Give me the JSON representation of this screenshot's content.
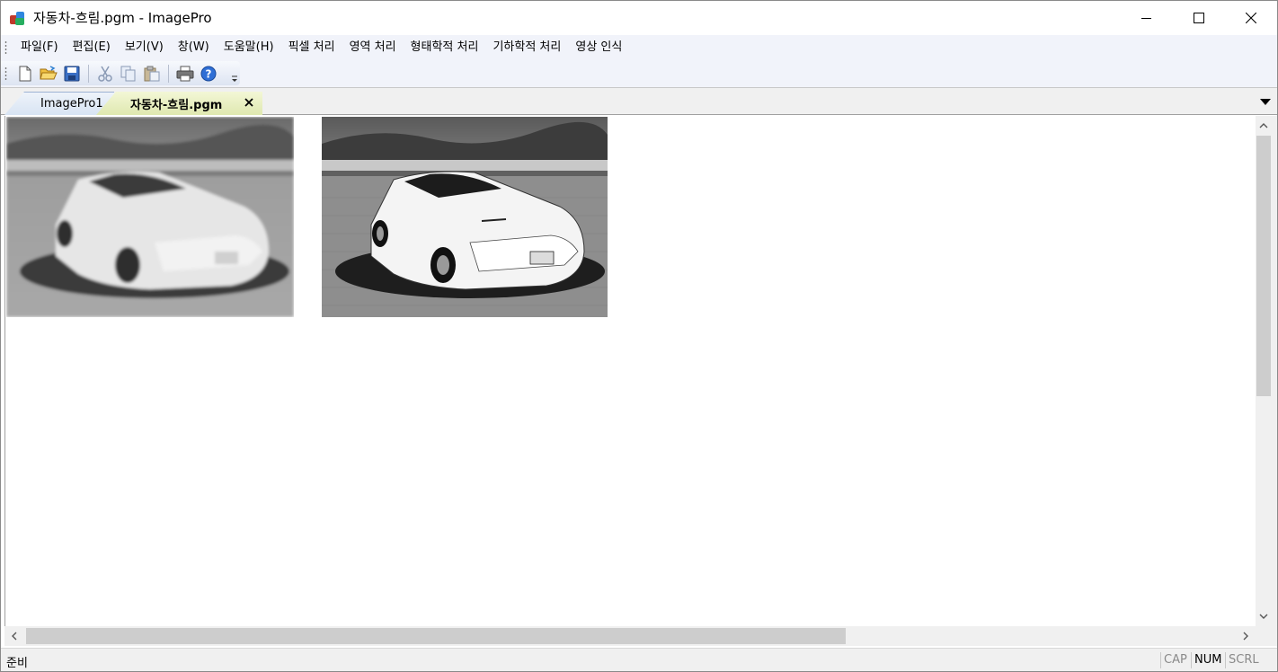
{
  "window": {
    "title": "자동차-흐림.pgm - ImagePro"
  },
  "menu": {
    "items": [
      "파일(F)",
      "편집(E)",
      "보기(V)",
      "창(W)",
      "도움말(H)",
      "픽셀 처리",
      "영역 처리",
      "형태학적 처리",
      "기하학적 처리",
      "영상 인식"
    ]
  },
  "toolbar": {
    "buttons": [
      "new-file-icon",
      "open-folder-icon",
      "save-icon",
      "cut-icon",
      "copy-icon",
      "paste-icon",
      "print-icon",
      "help-icon"
    ]
  },
  "tabs": [
    {
      "label": "ImagePro1"
    },
    {
      "label": "자동차-흐림.pgm"
    }
  ],
  "images": [
    {
      "name": "original-blurred-car"
    },
    {
      "name": "processed-car"
    }
  ],
  "status": {
    "text": "준비",
    "cap": "CAP",
    "num": "NUM",
    "scrl": "SCRL"
  }
}
